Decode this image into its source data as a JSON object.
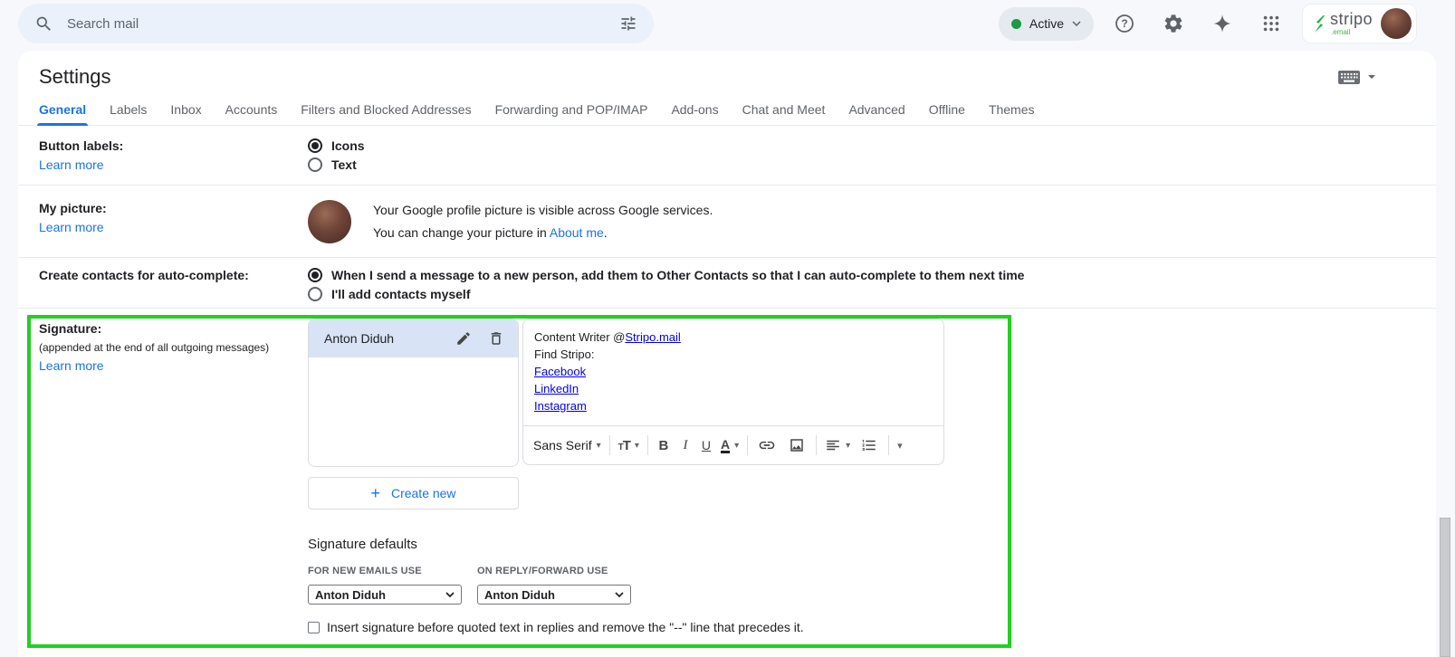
{
  "icons": {
    "caret_down": "▾",
    "plus": "+",
    "help": "?"
  },
  "colors": {
    "accent_blue": "#1a73e8",
    "classic_link_blue": "#0000ee",
    "highlight_green": "#21d021",
    "status_green": "#1a9a44",
    "brand_green": "#2eae4e",
    "search_bg": "#eaf1fb",
    "page_bg": "#f6f8fc",
    "selected_signature_bg": "#d8e3f6"
  },
  "header": {
    "search_placeholder": "Search mail",
    "status_label": "Active",
    "brand_name": "stripo",
    "brand_suffix": ".email"
  },
  "settings": {
    "title": "Settings",
    "tabs": [
      "General",
      "Labels",
      "Inbox",
      "Accounts",
      "Filters and Blocked Addresses",
      "Forwarding and POP/IMAP",
      "Add-ons",
      "Chat and Meet",
      "Advanced",
      "Offline",
      "Themes"
    ],
    "button_labels": {
      "label": "Button labels:",
      "learn_more": "Learn more",
      "option_icons": "Icons",
      "option_text": "Text"
    },
    "my_picture": {
      "label": "My picture:",
      "learn_more": "Learn more",
      "line1": "Your Google profile picture is visible across Google services.",
      "line2_prefix": "You can change your picture in ",
      "line2_link": "About me",
      "line2_suffix": "."
    },
    "auto_complete": {
      "label": "Create contacts for auto-complete:",
      "option1": "When I send a message to a new person, add them to Other Contacts so that I can auto-complete to them next time",
      "option2": "I'll add contacts myself"
    },
    "signature": {
      "label": "Signature:",
      "sublabel": "(appended at the end of all outgoing messages)",
      "learn_more": "Learn more",
      "name": "Anton Diduh",
      "content_line1_prefix": "Content Writer @",
      "content_line1_link": "Stripo.mail",
      "content_line2": "Find Stripo:",
      "content_links": [
        "Facebook",
        "LinkedIn",
        "Instagram"
      ],
      "toolbar": {
        "font": "Sans Serif",
        "bold": "B",
        "italic": "I",
        "underline": "U",
        "color": "A"
      },
      "create_new": "Create new",
      "defaults_heading": "Signature defaults",
      "for_new_label": "FOR NEW EMAILS USE",
      "on_reply_label": "ON REPLY/FORWARD USE",
      "for_new_value": "Anton Diduh",
      "on_reply_value": "Anton Diduh",
      "checkbox_label": "Insert signature before quoted text in replies and remove the \"--\" line that precedes it."
    }
  }
}
